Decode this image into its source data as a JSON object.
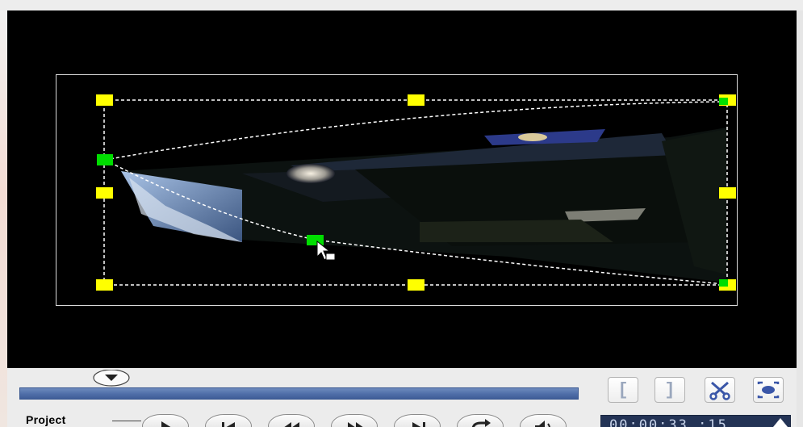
{
  "colors": {
    "viewer_background": "#000000",
    "resize_handle": "#ffff00",
    "warp_handle": "#00dd00",
    "scrub_track": "#4f6ea8",
    "timecode_background": "#233355"
  },
  "viewer": {
    "content": "video-frame-preview"
  },
  "scrubber": {
    "handle_icon": "triangle-down-icon"
  },
  "controls": {
    "project_label": "Project",
    "buttons": [
      {
        "name": "play-button",
        "icon": "play-icon"
      },
      {
        "name": "go-to-start-button",
        "icon": "go-to-start-icon"
      },
      {
        "name": "previous-frame-button",
        "icon": "rewind-icon"
      },
      {
        "name": "next-frame-button",
        "icon": "fast-forward-icon"
      },
      {
        "name": "go-to-end-button",
        "icon": "go-to-end-icon"
      },
      {
        "name": "repeat-button",
        "icon": "repeat-icon"
      },
      {
        "name": "volume-button",
        "icon": "speaker-icon"
      }
    ]
  },
  "edit_buttons": {
    "mark_in_label": "[",
    "mark_out_label": "]",
    "cut_icon": "scissors-icon",
    "fullscreen_icon": "enlarge-icon"
  },
  "timecode": {
    "value": "00:00:33 :15"
  }
}
